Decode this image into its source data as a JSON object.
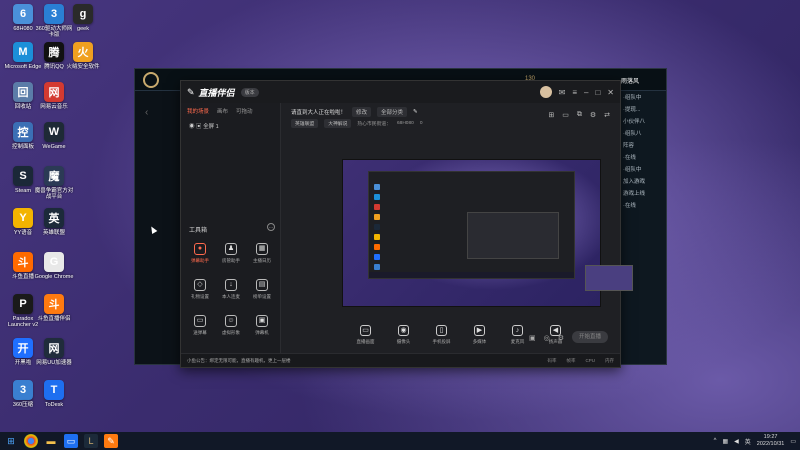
{
  "desktop_icons": [
    {
      "label": "68H080",
      "color": "#4a90d9"
    },
    {
      "label": "360驱动大师网卡版",
      "color": "#2a7fd4"
    },
    {
      "label": "geek",
      "color": "#2a2a2a"
    },
    {
      "label": "Microsoft Edge",
      "color": "#1c8fd8"
    },
    {
      "label": "腾讯QQ",
      "color": "#111111"
    },
    {
      "label": "火绒安全软件",
      "color": "#f0a020"
    },
    {
      "label": "回收站",
      "color": "#5b7ca8"
    },
    {
      "label": "网易云音乐",
      "color": "#d33a31"
    },
    {
      "label": "控制面板",
      "color": "#3b6fb5"
    },
    {
      "label": "WeGame",
      "color": "#1e2a36"
    },
    {
      "label": "Steam",
      "color": "#1b2838"
    },
    {
      "label": "魔兽争霸官方对战平台",
      "color": "#2b3a55"
    },
    {
      "label": "YY语音",
      "color": "#f3b400"
    },
    {
      "label": "英雄联盟",
      "color": "#1c2a3a"
    },
    {
      "label": "斗鱼直播",
      "color": "#ff6a00"
    },
    {
      "label": "Google Chrome",
      "color": "#e8e8e8"
    },
    {
      "label": "Paradox Launcher v2",
      "color": "#1a1a1a"
    },
    {
      "label": "斗鱼直播伴侣",
      "color": "#ff7a10"
    },
    {
      "label": "开黑啦",
      "color": "#1f6fff"
    },
    {
      "label": "网易UU加速器",
      "color": "#202c3c"
    },
    {
      "label": "360压缩",
      "color": "#3a7fd0"
    },
    {
      "label": "ToDesk",
      "color": "#1e6ff0"
    }
  ],
  "lol_client": {
    "right_panel_texts": [
      "·组队中",
      "·提现...",
      "小伙伴八",
      "·组队八",
      "阵容",
      "·在线",
      "·组队中",
      "加入游戏",
      "游戏上线",
      "·在线"
    ],
    "level": "130",
    "name": "·雨落风"
  },
  "app": {
    "brand": "直播伴侣",
    "version": "版本",
    "titlebar_icons": [
      "avatar",
      "mail-icon",
      "menu-icon",
      "minimize-icon",
      "maximize-icon",
      "close-icon"
    ],
    "tabs": [
      "我的场景",
      "画布",
      "可拖动"
    ],
    "active_tab": "我的场景",
    "scene_item": "全屏 1",
    "tools_header": "工具箱",
    "tools": [
      {
        "label": "弹幕助手",
        "icon": "●",
        "hot": true
      },
      {
        "label": "房管助手",
        "icon": "♟",
        "hot": false
      },
      {
        "label": "主播日历",
        "icon": "▦",
        "hot": false
      },
      {
        "label": "礼物设置",
        "icon": "◇",
        "hot": false
      },
      {
        "label": "本人连麦",
        "icon": "↓",
        "hot": false
      },
      {
        "label": "榜单设置",
        "icon": "▤",
        "hot": false
      },
      {
        "label": "送弹幕",
        "icon": "▭",
        "hot": false
      },
      {
        "label": "虚拟形象",
        "icon": "☺",
        "hot": false
      },
      {
        "label": "弹幕机",
        "icon": "▣",
        "hot": false
      }
    ],
    "stream_title": "请直到大人正在啦啦！",
    "chip_edit": "修改",
    "chip_category": "全部分类",
    "info2": [
      "英雄联盟",
      "大神解说",
      "热心市民街道：",
      "68H080",
      "0"
    ],
    "controls": [
      {
        "label": "直播画面",
        "icon": "▭"
      },
      {
        "label": "摄像头",
        "icon": "◉"
      },
      {
        "label": "手机投屏",
        "icon": "▯"
      },
      {
        "label": "多媒体",
        "icon": "▶"
      },
      {
        "label": "麦克风",
        "icon": "♪"
      },
      {
        "label": "扬声器",
        "icon": "◀"
      }
    ],
    "start_button": "开始直播",
    "status_bar": [
      "小鱼公告：绑定无限可能，直播有趣机，更上一层楼",
      "码率",
      "帧率",
      "CPU",
      "内存"
    ]
  },
  "taskbar": {
    "time": "19:27",
    "date": "2022/10/31",
    "tray_text": "英"
  }
}
